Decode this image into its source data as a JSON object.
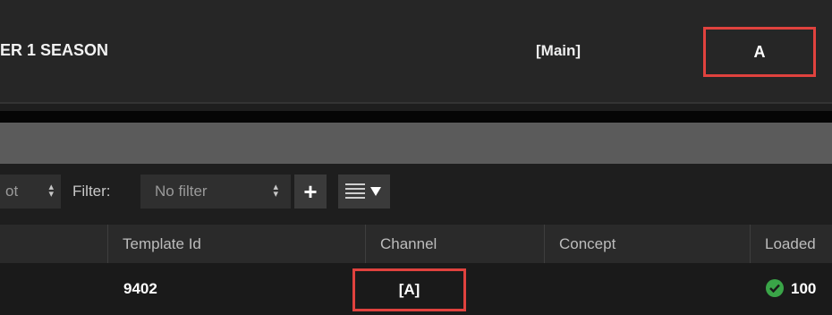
{
  "topbar": {
    "title": "ER 1 SEASON",
    "main_label": "[Main]",
    "channel": "A"
  },
  "toolbar": {
    "sort_fragment": "ot",
    "filter_label": "Filter:",
    "filter_value": "No filter",
    "add_label": "+"
  },
  "table": {
    "columns": [
      "Template Id",
      "Channel",
      "Concept",
      "Loaded"
    ],
    "rows": [
      {
        "template_id": "9402",
        "channel": "[A]",
        "concept": "",
        "loaded": "100"
      }
    ]
  },
  "colors": {
    "highlight": "#e0423e",
    "ok": "#3aa548"
  },
  "icons": [
    "sort-arrows-icon",
    "add-icon",
    "list-view-icon",
    "dropdown-caret-icon",
    "check-circle-icon"
  ]
}
